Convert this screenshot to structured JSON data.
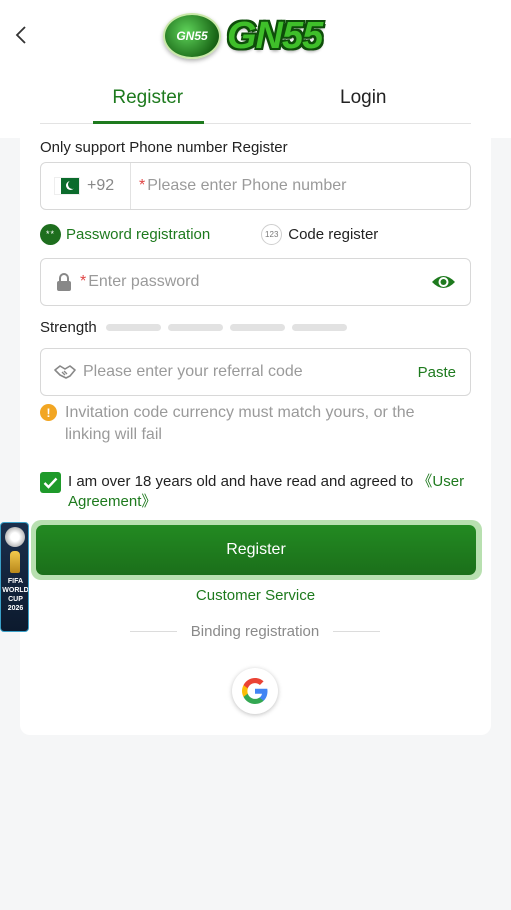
{
  "header": {
    "logo_badge": "GN55",
    "logo_text": "GN55",
    "tabs": [
      {
        "label": "Register",
        "active": true
      },
      {
        "label": "Login",
        "active": false
      }
    ]
  },
  "form": {
    "phone_hint": "Only support Phone number Register",
    "country_code": "+92",
    "phone_required_mark": "*",
    "phone_placeholder": "Please enter Phone number",
    "mode_options": [
      {
        "label": "Password registration",
        "badge": "**",
        "selected": true
      },
      {
        "label": "Code register",
        "badge": "123",
        "selected": false
      }
    ],
    "password_required_mark": "*",
    "password_placeholder": "Enter password",
    "strength_label": "Strength",
    "strength_level": 0,
    "referral_placeholder": "Please enter your referral code",
    "paste_label": "Paste",
    "warning_text": "Invitation code currency must match yours, or the linking will fail",
    "agree_checked": true,
    "agree_text": "I am over 18 years old and have read and agreed to ",
    "agree_link": "《User Agreement》",
    "register_button": "Register",
    "customer_service": "Customer Service",
    "binding_label": "Binding registration"
  },
  "floating_banner": {
    "text": "FIFA WORLD CUP 2026"
  },
  "colors": {
    "accent": "#1e7a1e",
    "button": "#1e7a1e",
    "warning": "#f2a623",
    "required": "#e04545"
  },
  "icons": {
    "back": "chevron-left-icon",
    "flag": "pakistan-flag-icon",
    "lock": "lock-icon",
    "eye": "eye-icon",
    "referral": "handshake-icon",
    "warning": "warning-icon",
    "check": "check-icon",
    "google": "google-icon"
  }
}
